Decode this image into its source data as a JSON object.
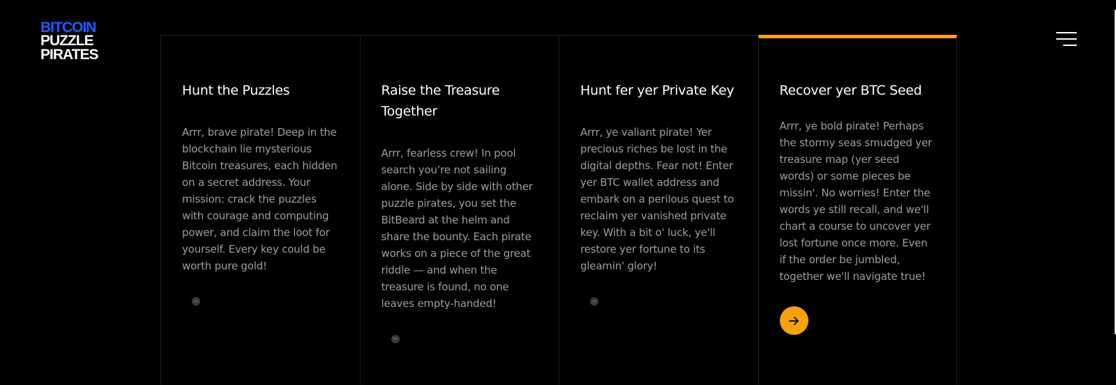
{
  "logo": {
    "line1": "BITCOIN",
    "line2": "PUZZLE",
    "line3": "PIRATES"
  },
  "colors": {
    "accent": "#f7a10f",
    "brand_blue": "#1a5cff",
    "background": "#000000"
  },
  "cards": [
    {
      "title": "Hunt the Puzzles",
      "text": "Arrr, brave pirate! Deep in the blockchain lie mysterious Bitcoin treasures, each hidden on a secret address. Your mission: crack the puzzles with courage and computing power, and claim the loot for yourself. Every key could be worth pure gold!",
      "active": false,
      "icon": "plus-dot-icon"
    },
    {
      "title": "Raise the Treasure Together",
      "text": "Arrr, fearless crew! In pool search you’re not sailing alone. Side by side with other puzzle pirates, you set the BitBeard at the helm and share the bounty. Each pirate works on a piece of the great riddle — and when the treasure is found, no one leaves empty-handed!",
      "active": false,
      "icon": "plus-dot-icon"
    },
    {
      "title": "Hunt fer yer Private Key",
      "text": "Arrr, ye valiant pirate! Yer precious riches be lost in the digital depths. Fear not! Enter yer BTC wallet address and embark on a perilous quest to reclaim yer vanished private key. With a bit o' luck, ye'll restore yer fortune to its gleamin' glory!",
      "active": false,
      "icon": "plus-dot-icon"
    },
    {
      "title": "Recover yer BTC Seed",
      "text": "Arrr, ye bold pirate! Perhaps the stormy seas smudged yer treasure map (yer seed words) or some pieces be missin'. No worries! Enter the words ye still recall, and we'll chart a course to uncover yer lost fortune once more. Even if the order be jumbled, together we'll navigate true!",
      "active": true,
      "icon": "arrow-right-icon"
    }
  ]
}
